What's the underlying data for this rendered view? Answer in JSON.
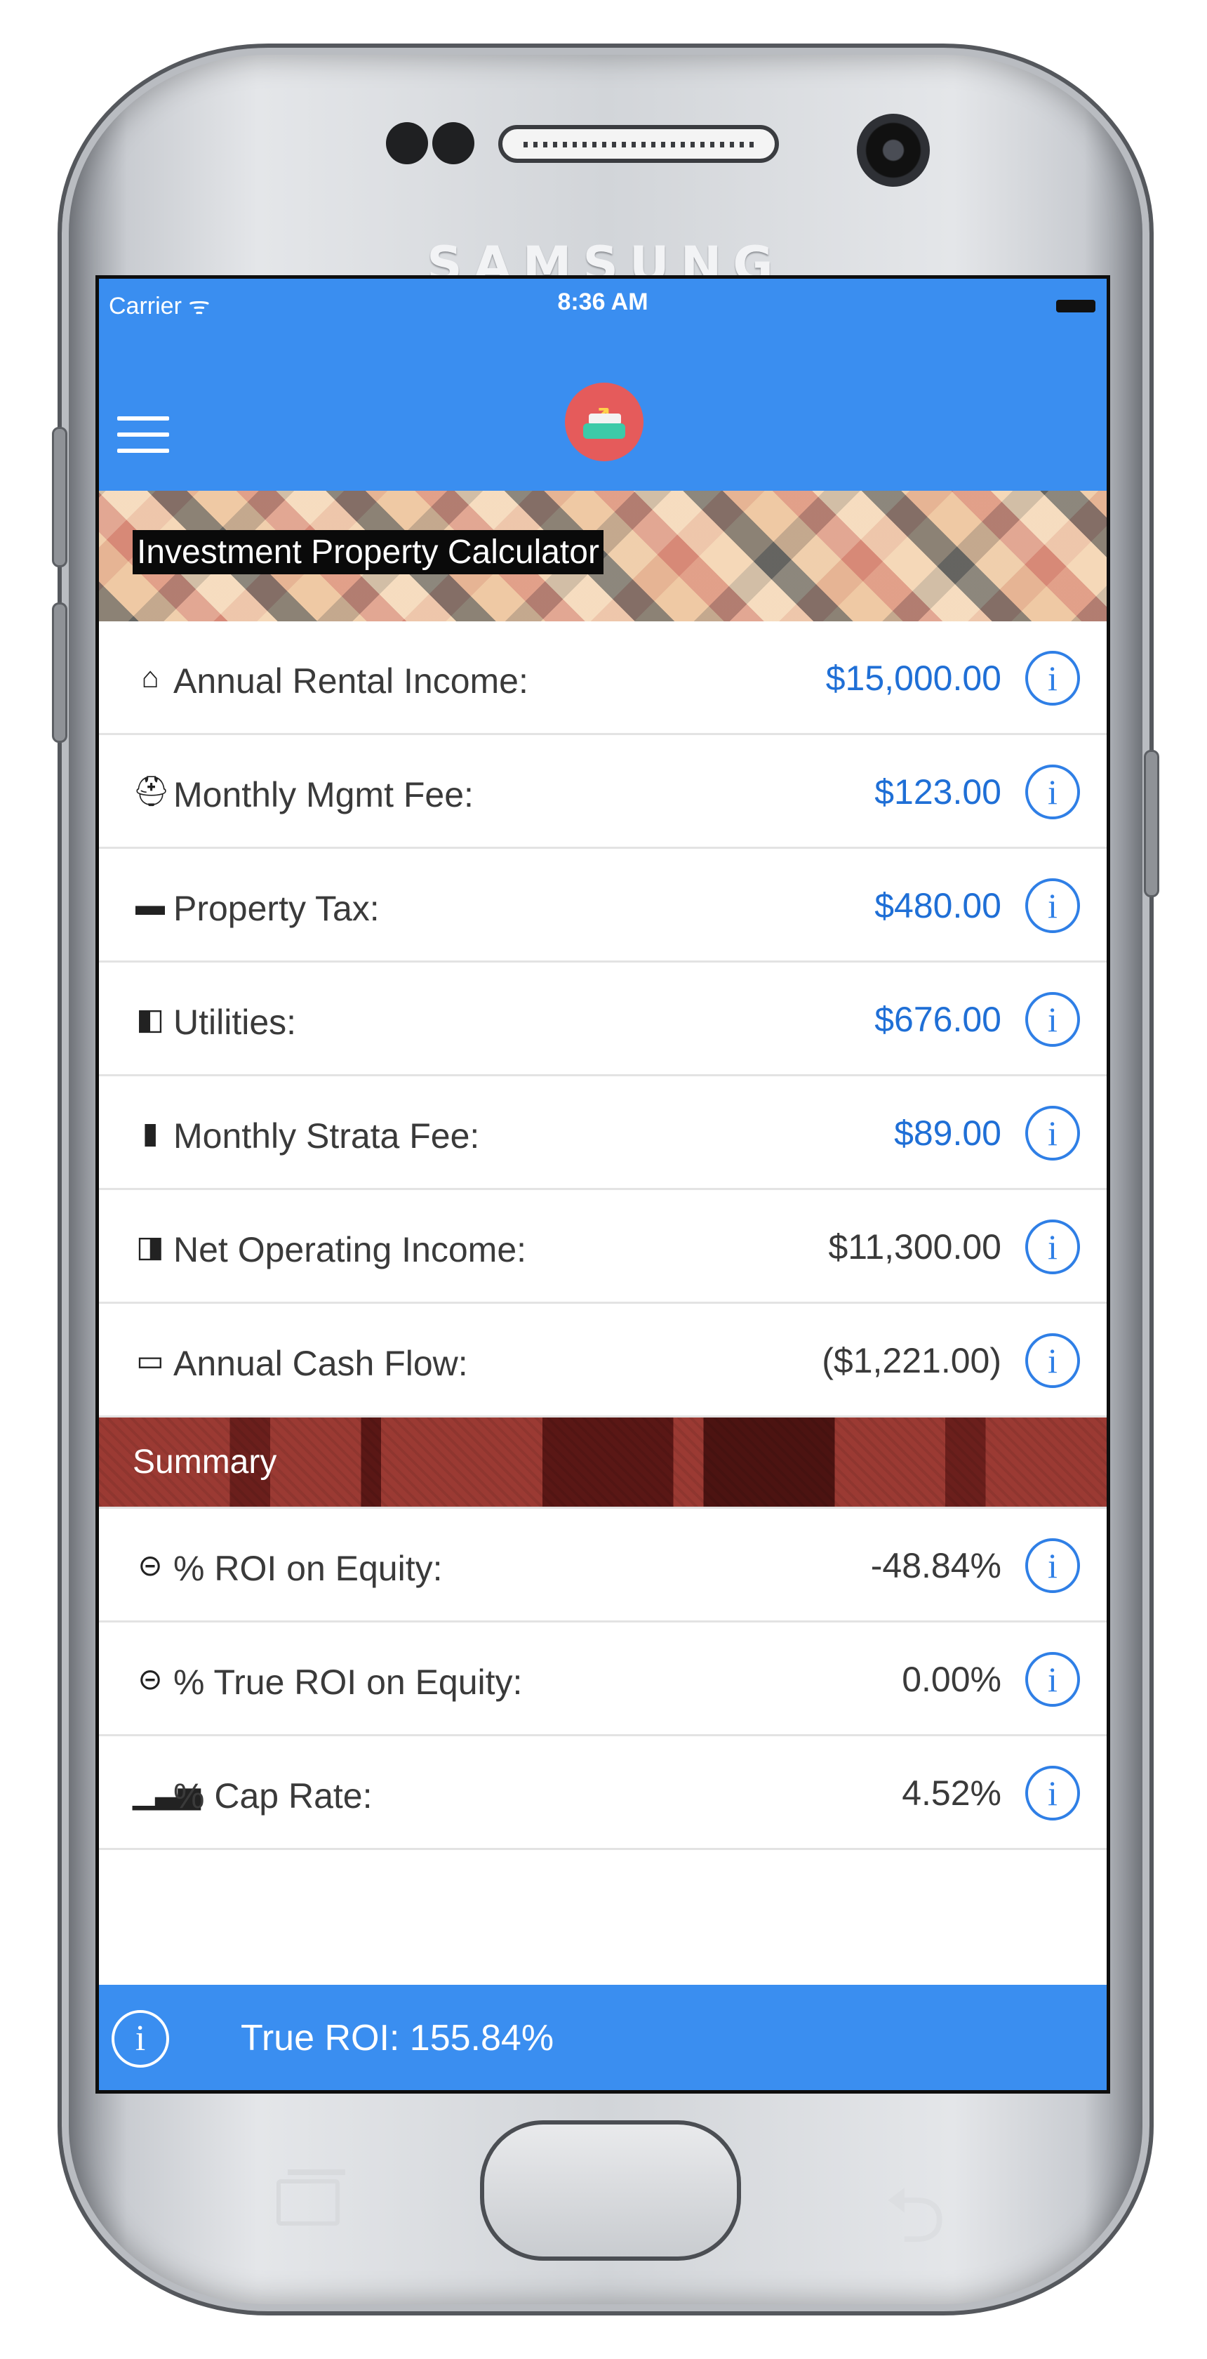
{
  "device": {
    "brand": "SAMSUNG"
  },
  "status_bar": {
    "carrier": "Carrier ᯤ",
    "time": "8:36 AM"
  },
  "header": {
    "menu_icon": "hamburger-menu-icon",
    "logo_icon": "investment-chart-logo-icon",
    "banner_title": "Investment Property Calculator"
  },
  "inputs": [
    {
      "icon": "home-icon",
      "glyph": "⌂",
      "label": "Annual Rental Income:",
      "value": "$15,000.00",
      "editable": true
    },
    {
      "icon": "user-icon",
      "glyph": "⛑",
      "label": "Monthly Mgmt Fee:",
      "value": "$123.00",
      "editable": true
    },
    {
      "icon": "briefcase-icon",
      "glyph": "▬",
      "label": "Property Tax:",
      "value": "$480.00",
      "editable": true
    },
    {
      "icon": "panel-icon",
      "glyph": "◧",
      "label": "Utilities:",
      "value": "$676.00",
      "editable": true
    },
    {
      "icon": "book-icon",
      "glyph": "▮",
      "label": "Monthly Strata Fee:",
      "value": "$89.00",
      "editable": true
    },
    {
      "icon": "copy-icon",
      "glyph": "◨",
      "label": "Net Operating Income:",
      "value": "$11,300.00",
      "editable": false
    },
    {
      "icon": "cash-icon",
      "glyph": "▭",
      "label": "Annual Cash Flow:",
      "value": "($1,221.00)",
      "editable": false
    }
  ],
  "summary": {
    "title": "Summary",
    "rows": [
      {
        "icon": "login-icon",
        "glyph": "⊝",
        "label": "% ROI on Equity:",
        "value": "-48.84%"
      },
      {
        "icon": "login-icon",
        "glyph": "⊝",
        "label": "% True ROI on Equity:",
        "value": "0.00%"
      },
      {
        "icon": "bar-chart-icon",
        "glyph": "▁▃▅",
        "label": "% Cap Rate:",
        "value": "4.52%"
      }
    ]
  },
  "footer": {
    "text": "True ROI: 155.84%",
    "info_glyph": "i"
  },
  "info_glyph": "i",
  "colors": {
    "accent": "#3a8ef0",
    "input_value": "#1f6fd6",
    "summary_bg": "#9b3a33"
  }
}
